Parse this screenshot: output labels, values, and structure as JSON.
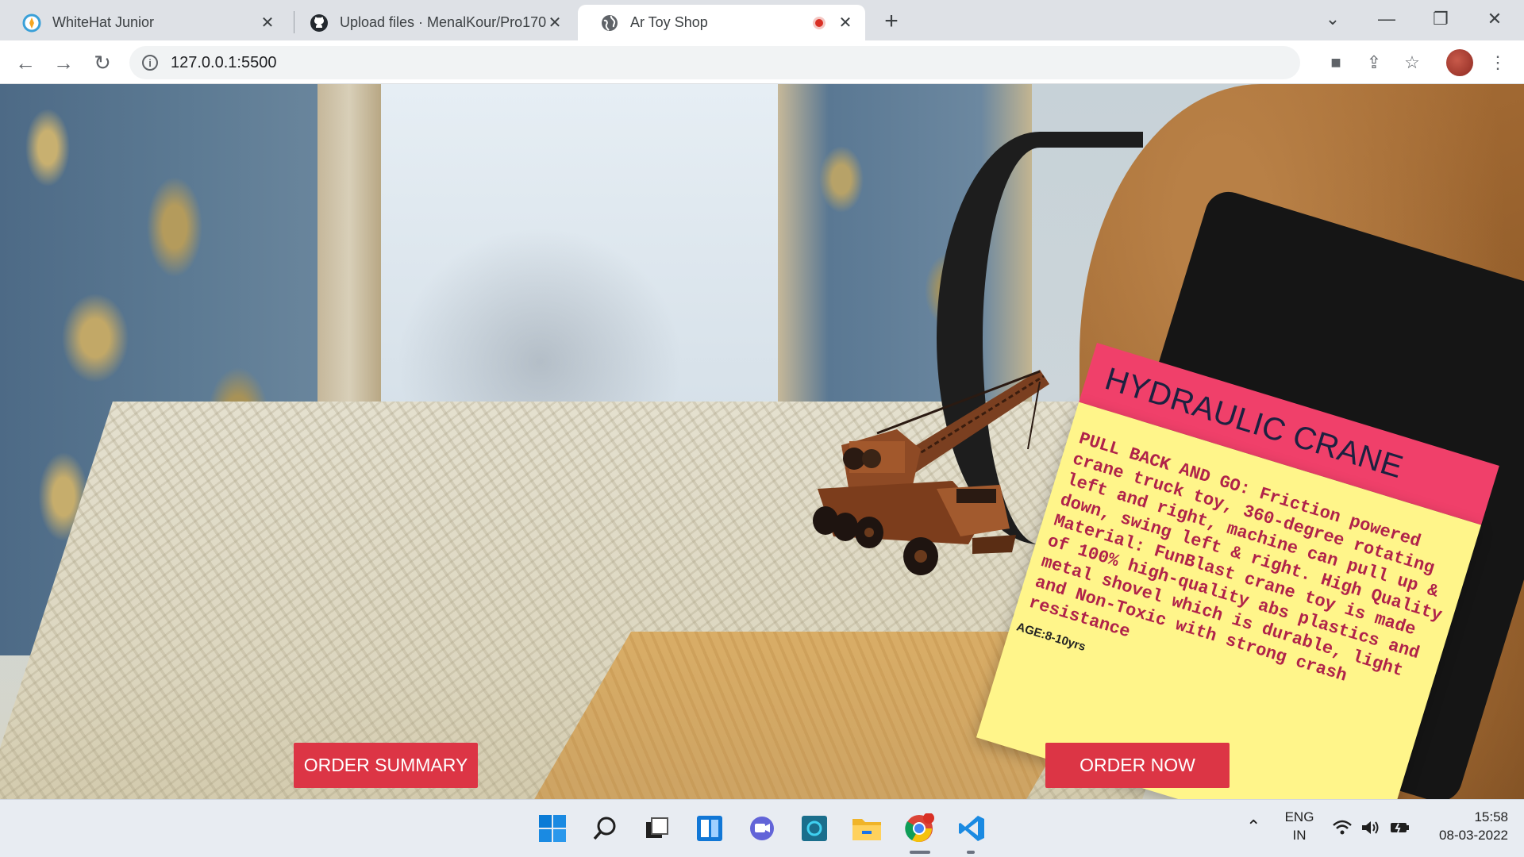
{
  "browser": {
    "tabs": [
      {
        "title": "WhiteHat Junior",
        "favicon": "whitehat-logo-icon"
      },
      {
        "title": "Upload files · MenalKour/Pro170",
        "favicon": "github-icon"
      },
      {
        "title": "Ar Toy Shop",
        "favicon": "globe-icon",
        "active": true,
        "recording": true
      }
    ],
    "url": "127.0.0.1:5500"
  },
  "scene": {
    "model": "hydraulic-crane-toy",
    "card": {
      "title": "HYDRAULIC CRANE",
      "description": "PULL BACK AND GO: Friction powered crane truck toy, 360-degree rotating left and right, machine can pull up & down, swing left & right. High Quality Material: FunBlast crane toy is made of 100% high-quality abs plastics and metal shovel which is durable, light and Non-Toxic with strong crash resistance",
      "age": "AGE:8-10yrs"
    }
  },
  "buttons": {
    "summary": "ORDER SUMMARY",
    "order": "ORDER NOW"
  },
  "taskbar": {
    "apps": [
      "start-icon",
      "search-icon",
      "task-view-icon",
      "widgets-icon",
      "chat-icon",
      "cortana-icon",
      "file-explorer-icon",
      "chrome-icon",
      "vscode-icon"
    ],
    "lang_top": "ENG",
    "lang_bottom": "IN",
    "time": "15:58",
    "date": "08-03-2022"
  },
  "colors": {
    "accent_button": "#dc3545",
    "card_header": "#f0406a",
    "card_body": "#fff58a",
    "card_text": "#b0224a"
  }
}
